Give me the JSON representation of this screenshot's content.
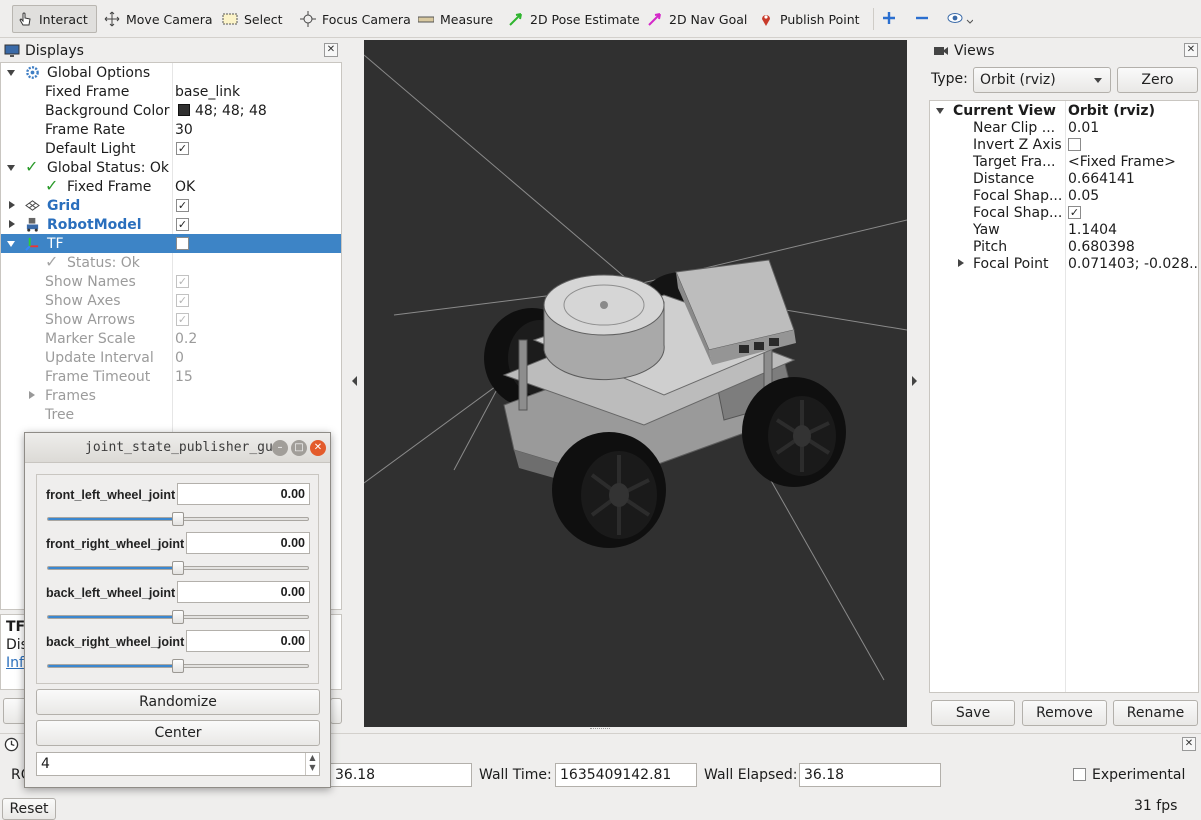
{
  "toolbar": {
    "items": [
      {
        "label": "Interact",
        "icon": "hand-pointer-icon"
      },
      {
        "label": "Move Camera",
        "icon": "move-camera-icon"
      },
      {
        "label": "Select",
        "icon": "select-icon"
      },
      {
        "label": "Focus Camera",
        "icon": "focus-camera-icon"
      },
      {
        "label": "Measure",
        "icon": "ruler-icon"
      },
      {
        "label": "2D Pose Estimate",
        "icon": "green-arrow-icon"
      },
      {
        "label": "2D Nav Goal",
        "icon": "magenta-arrow-icon"
      },
      {
        "label": "Publish Point",
        "icon": "map-pin-icon"
      }
    ]
  },
  "displays": {
    "title": "Displays",
    "rows": {
      "global_options": "Global Options",
      "fixed_frame": {
        "name": "Fixed Frame",
        "value": "base_link"
      },
      "background_color": {
        "name": "Background Color",
        "value": "48; 48; 48",
        "swatch": "#303030"
      },
      "frame_rate": {
        "name": "Frame Rate",
        "value": "30"
      },
      "default_light": {
        "name": "Default Light"
      },
      "global_status": "Global Status: Ok",
      "fixed_frame_status": {
        "name": "Fixed Frame",
        "value": "OK"
      },
      "grid": "Grid",
      "robot_model": "RobotModel",
      "tf": "TF",
      "tf_status": "Status: Ok",
      "show_names": "Show Names",
      "show_axes": "Show Axes",
      "show_arrows": "Show Arrows",
      "marker_scale": {
        "name": "Marker Scale",
        "value": "0.2"
      },
      "update_interval": {
        "name": "Update Interval",
        "value": "0"
      },
      "frame_timeout": {
        "name": "Frame Timeout",
        "value": "15"
      },
      "frames": "Frames",
      "tree": "Tree"
    },
    "desc_title": "TF",
    "desc_text": "Dis",
    "desc_link": "Inf"
  },
  "views": {
    "title": "Views",
    "type_label": "Type:",
    "type_value": "Orbit (rviz)",
    "zero_label": "Zero",
    "header": {
      "name": "Current View",
      "value": "Orbit (rviz)"
    },
    "rows": [
      {
        "name": "Near Clip ...",
        "value": "0.01"
      },
      {
        "name": "Invert Z Axis",
        "value": ""
      },
      {
        "name": "Target Fra...",
        "value": "<Fixed Frame>"
      },
      {
        "name": "Distance",
        "value": "0.664141"
      },
      {
        "name": "Focal Shap...",
        "value": "0.05"
      },
      {
        "name": "Focal Shap...",
        "value": ""
      },
      {
        "name": "Yaw",
        "value": "1.1404"
      },
      {
        "name": "Pitch",
        "value": "0.680398"
      },
      {
        "name": "Focal Point",
        "value": "0.071403; -0.028..."
      }
    ],
    "save_label": "Save",
    "remove_label": "Remove",
    "rename_label": "Rename"
  },
  "time": {
    "ros_prefix": "RO",
    "ros_elapsed_value": "36.18",
    "wall_time_label": "Wall Time:",
    "wall_time_value": "1635409142.81",
    "wall_elapsed_label": "Wall Elapsed:",
    "wall_elapsed_value": "36.18",
    "experimental_label": "Experimental",
    "reset_label": "Reset",
    "fps": "31 fps"
  },
  "jsp": {
    "title": "joint_state_publisher_gui",
    "joints": [
      {
        "name": "front_left_wheel_joint",
        "value": "0.00",
        "position": 0.5
      },
      {
        "name": "front_right_wheel_joint",
        "value": "0.00",
        "position": 0.5
      },
      {
        "name": "back_left_wheel_joint",
        "value": "0.00",
        "position": 0.5
      },
      {
        "name": "back_right_wheel_joint",
        "value": "0.00",
        "position": 0.5
      }
    ],
    "randomize_label": "Randomize",
    "center_label": "Center",
    "spin_value": "4"
  },
  "colors": {
    "accent": "#3d84c6",
    "viewport_bg": "#303030",
    "link": "#2a6fbd"
  }
}
